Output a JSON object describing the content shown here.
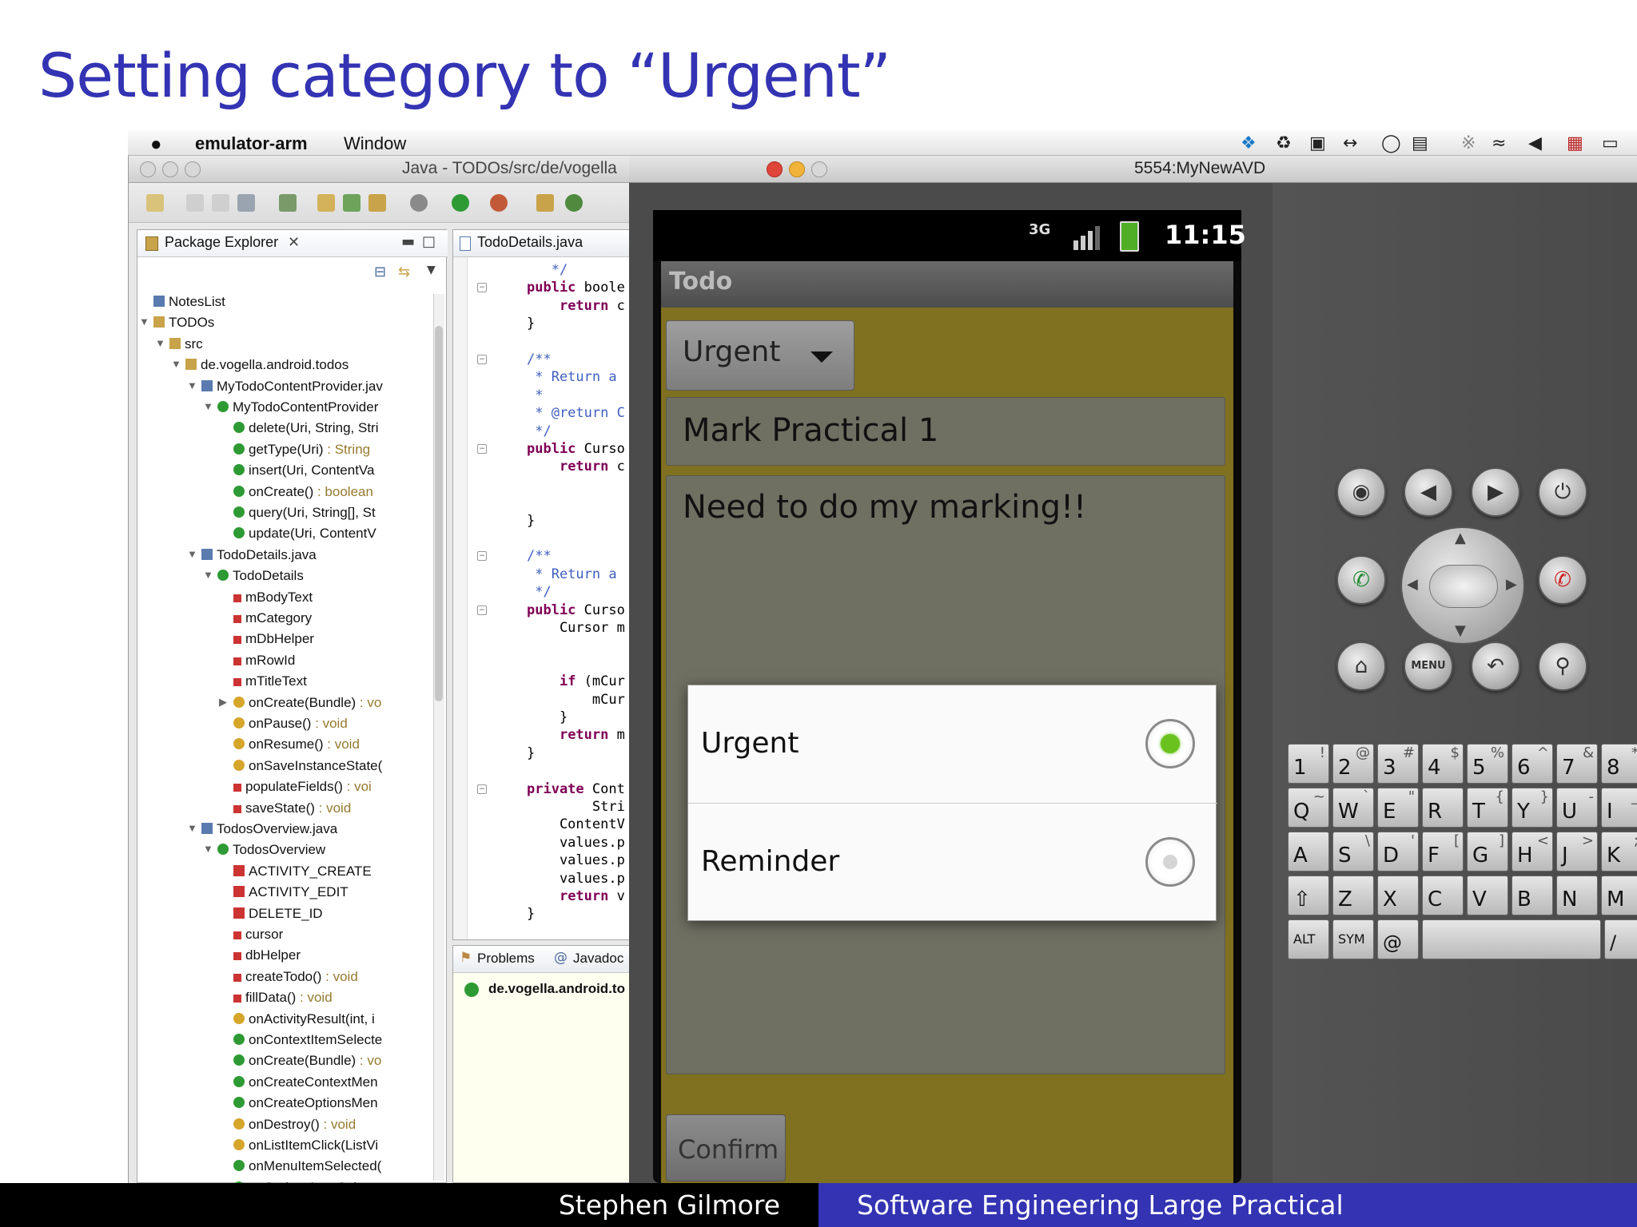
{
  "slide": {
    "title": "Setting category to “Urgent”"
  },
  "menubar": {
    "app_name": "emulator-arm",
    "menu_window": "Window",
    "icons": [
      "dropbox-icon",
      "evernote-icon",
      "truck-icon",
      "arrows-icon",
      "clock-icon",
      "display-icon",
      "bluetooth-icon",
      "wifi-icon",
      "volume-icon",
      "flag-icon",
      "battery-icon"
    ]
  },
  "eclipse": {
    "window_title": "Java - TODOs/src/de/vogella",
    "package_explorer_tab": "Package Explorer",
    "tree": [
      {
        "label": "NotesList",
        "type": "",
        "indent": 1,
        "icon": "folder"
      },
      {
        "label": "TODOs",
        "type": "",
        "indent": 1,
        "icon": "project",
        "arrow": "down"
      },
      {
        "label": "src",
        "type": "",
        "indent": 2,
        "icon": "src",
        "arrow": "down"
      },
      {
        "label": "de.vogella.android.todos",
        "type": "",
        "indent": 3,
        "icon": "package",
        "arrow": "down"
      },
      {
        "label": "MyTodoContentProvider.jav",
        "type": "",
        "indent": 4,
        "icon": "file",
        "arrow": "down"
      },
      {
        "label": "MyTodoContentProvider",
        "type": "",
        "indent": 5,
        "icon": "class",
        "arrow": "down"
      },
      {
        "label": "delete(Uri, String, Stri",
        "type": "",
        "indent": 6,
        "icon": "method"
      },
      {
        "label": "getType(Uri)",
        "type": " : String",
        "indent": 6,
        "icon": "method"
      },
      {
        "label": "insert(Uri, ContentVa",
        "type": "",
        "indent": 6,
        "icon": "method"
      },
      {
        "label": "onCreate()",
        "type": " : boolean",
        "indent": 6,
        "icon": "method"
      },
      {
        "label": "query(Uri, String[], St",
        "type": "",
        "indent": 6,
        "icon": "method"
      },
      {
        "label": "update(Uri, ContentV",
        "type": "",
        "indent": 6,
        "icon": "method"
      },
      {
        "label": "TodoDetails.java",
        "type": "",
        "indent": 4,
        "icon": "file",
        "arrow": "down"
      },
      {
        "label": "TodoDetails",
        "type": "",
        "indent": 5,
        "icon": "class",
        "arrow": "down"
      },
      {
        "label": "mBodyText",
        "type": "",
        "indent": 6,
        "icon": "field"
      },
      {
        "label": "mCategory",
        "type": "",
        "indent": 6,
        "icon": "field"
      },
      {
        "label": "mDbHelper",
        "type": "",
        "indent": 6,
        "icon": "field"
      },
      {
        "label": "mRowId",
        "type": "",
        "indent": 6,
        "icon": "field"
      },
      {
        "label": "mTitleText",
        "type": "",
        "indent": 6,
        "icon": "field"
      },
      {
        "label": "onCreate(Bundle)",
        "type": " : vo",
        "indent": 6,
        "icon": "protected",
        "arrow": "right"
      },
      {
        "label": "onPause()",
        "type": " : void",
        "indent": 6,
        "icon": "protected"
      },
      {
        "label": "onResume()",
        "type": " : void",
        "indent": 6,
        "icon": "protected"
      },
      {
        "label": "onSaveInstanceState(",
        "type": "",
        "indent": 6,
        "icon": "protected"
      },
      {
        "label": "populateFields()",
        "type": " : voi",
        "indent": 6,
        "icon": "private"
      },
      {
        "label": "saveState()",
        "type": " : void",
        "indent": 6,
        "icon": "private"
      },
      {
        "label": "TodosOverview.java",
        "type": "",
        "indent": 4,
        "icon": "file",
        "arrow": "down"
      },
      {
        "label": "TodosOverview",
        "type": "",
        "indent": 5,
        "icon": "class",
        "arrow": "down"
      },
      {
        "label": "ACTIVITY_CREATE",
        "type": "",
        "indent": 6,
        "icon": "const"
      },
      {
        "label": "ACTIVITY_EDIT",
        "type": "",
        "indent": 6,
        "icon": "const"
      },
      {
        "label": "DELETE_ID",
        "type": "",
        "indent": 6,
        "icon": "const"
      },
      {
        "label": "cursor",
        "type": "",
        "indent": 6,
        "icon": "field"
      },
      {
        "label": "dbHelper",
        "type": "",
        "indent": 6,
        "icon": "field"
      },
      {
        "label": "createTodo()",
        "type": " : void",
        "indent": 6,
        "icon": "private"
      },
      {
        "label": "fillData()",
        "type": " : void",
        "indent": 6,
        "icon": "private"
      },
      {
        "label": "onActivityResult(int, i",
        "type": "",
        "indent": 6,
        "icon": "protected"
      },
      {
        "label": "onContextItemSelecte",
        "type": "",
        "indent": 6,
        "icon": "method"
      },
      {
        "label": "onCreate(Bundle)",
        "type": " : vo",
        "indent": 6,
        "icon": "method"
      },
      {
        "label": "onCreateContextMen",
        "type": "",
        "indent": 6,
        "icon": "method"
      },
      {
        "label": "onCreateOptionsMen",
        "type": "",
        "indent": 6,
        "icon": "method"
      },
      {
        "label": "onDestroy()",
        "type": " : void",
        "indent": 6,
        "icon": "protected"
      },
      {
        "label": "onListItemClick(ListVi",
        "type": "",
        "indent": 6,
        "icon": "protected"
      },
      {
        "label": "onMenuItemSelected(",
        "type": "",
        "indent": 6,
        "icon": "method"
      },
      {
        "label": "onOptionsItemSelecte",
        "type": "",
        "indent": 6,
        "icon": "method"
      }
    ],
    "editor_tab": "TodoDetails.java",
    "code": [
      {
        "t": "   */",
        "c": "cm",
        "fold": false
      },
      {
        "t": "public boole",
        "c": "kw2",
        "fold": true,
        "kwlen": 6
      },
      {
        "t": "    return c",
        "c": "kw2",
        "fold": false,
        "pre": 4,
        "kwlen": 6
      },
      {
        "t": "}",
        "c": "",
        "fold": false
      },
      {
        "t": "",
        "c": "",
        "fold": false
      },
      {
        "t": "/**",
        "c": "cm",
        "fold": true
      },
      {
        "t": " * Return a",
        "c": "cm",
        "fold": false
      },
      {
        "t": " *",
        "c": "cm",
        "fold": false
      },
      {
        "t": " * @return C",
        "c": "cm",
        "fold": false
      },
      {
        "t": " */",
        "c": "cm",
        "fold": false
      },
      {
        "t": "public Curso",
        "c": "kw2",
        "fold": true,
        "kwlen": 6
      },
      {
        "t": "    return c",
        "c": "kw2",
        "fold": false,
        "pre": 4,
        "kwlen": 6
      },
      {
        "t": "",
        "c": "",
        "fold": false
      },
      {
        "t": "",
        "c": "",
        "fold": false
      },
      {
        "t": "}",
        "c": "",
        "fold": false
      },
      {
        "t": "",
        "c": "",
        "fold": false
      },
      {
        "t": "/**",
        "c": "cm",
        "fold": true
      },
      {
        "t": " * Return a",
        "c": "cm",
        "fold": false
      },
      {
        "t": " */",
        "c": "cm",
        "fold": false
      },
      {
        "t": "public Curso",
        "c": "kw2",
        "fold": true,
        "kwlen": 6
      },
      {
        "t": "    Cursor m",
        "c": "",
        "fold": false
      },
      {
        "t": "",
        "c": "",
        "fold": false
      },
      {
        "t": "",
        "c": "",
        "fold": false
      },
      {
        "t": "    if (mCur",
        "c": "kw2",
        "fold": false,
        "pre": 4,
        "kwlen": 2
      },
      {
        "t": "        mCur",
        "c": "",
        "fold": false
      },
      {
        "t": "    }",
        "c": "",
        "fold": false
      },
      {
        "t": "    return m",
        "c": "kw2",
        "fold": false,
        "pre": 4,
        "kwlen": 6
      },
      {
        "t": "}",
        "c": "",
        "fold": false
      },
      {
        "t": "",
        "c": "",
        "fold": false
      },
      {
        "t": "private Cont",
        "c": "kw2",
        "fold": true,
        "kwlen": 7
      },
      {
        "t": "        Stri",
        "c": "",
        "fold": false
      },
      {
        "t": "    ContentV",
        "c": "",
        "fold": false
      },
      {
        "t": "    values.p",
        "c": "",
        "fold": false
      },
      {
        "t": "    values.p",
        "c": "",
        "fold": false
      },
      {
        "t": "    values.p",
        "c": "",
        "fold": false
      },
      {
        "t": "    return v",
        "c": "kw2",
        "fold": false,
        "pre": 4,
        "kwlen": 6
      },
      {
        "t": "}",
        "c": "",
        "fold": false
      },
      {
        "t": "",
        "c": "",
        "fold": false
      },
      {
        "t": "}",
        "c": "",
        "fold": false
      }
    ],
    "problems_tab": "Problems",
    "javadoc_tab": "Javadoc",
    "javadoc_content": "de.vogella.android.to"
  },
  "emulator": {
    "window_title": "5554:MyNewAVD",
    "status_time": "11:15",
    "network_label": "3G",
    "app_title": "Todo",
    "category_selected": "Urgent",
    "title_field": "Mark Practical 1",
    "body_field": "Need to do my marking!!",
    "dialog_options": [
      {
        "label": "Urgent",
        "selected": true
      },
      {
        "label": "Reminder",
        "selected": false
      }
    ],
    "confirm_button": "Confirm",
    "controls": {
      "menu_label": "MENU"
    },
    "keyboard": {
      "row1": [
        [
          "1",
          "!"
        ],
        [
          "2",
          "@"
        ],
        [
          "3",
          "#"
        ],
        [
          "4",
          "$"
        ],
        [
          "5",
          "%"
        ],
        [
          "6",
          "^"
        ],
        [
          "7",
          "&"
        ],
        [
          "8",
          "*"
        ]
      ],
      "row2": [
        [
          "Q",
          "~"
        ],
        [
          "W",
          "`"
        ],
        [
          "E",
          "\""
        ],
        [
          "R",
          ""
        ],
        [
          "T",
          "{"
        ],
        [
          "Y",
          "}"
        ],
        [
          "U",
          "-"
        ],
        [
          "I",
          "_"
        ]
      ],
      "row3": [
        [
          "A",
          ""
        ],
        [
          "S",
          "\\"
        ],
        [
          "D",
          "'"
        ],
        [
          "F",
          "["
        ],
        [
          "G",
          "]"
        ],
        [
          "H",
          "<"
        ],
        [
          "J",
          ">"
        ],
        [
          "K",
          ";"
        ]
      ],
      "row4": [
        [
          "⇧",
          ""
        ],
        [
          "Z",
          ""
        ],
        [
          "X",
          ""
        ],
        [
          "C",
          ""
        ],
        [
          "V",
          ""
        ],
        [
          "B",
          ""
        ],
        [
          "N",
          ""
        ],
        [
          "M",
          ""
        ]
      ],
      "alt": "ALT",
      "sym": "SYM",
      "at": "@",
      "slash": "/"
    }
  },
  "footer": {
    "author": "Stephen Gilmore",
    "course": "Software Engineering Large Practical"
  },
  "colors": {
    "title_blue": "#3333b3",
    "app_bg": "#7f7120",
    "radio_on": "#6ac21e"
  }
}
